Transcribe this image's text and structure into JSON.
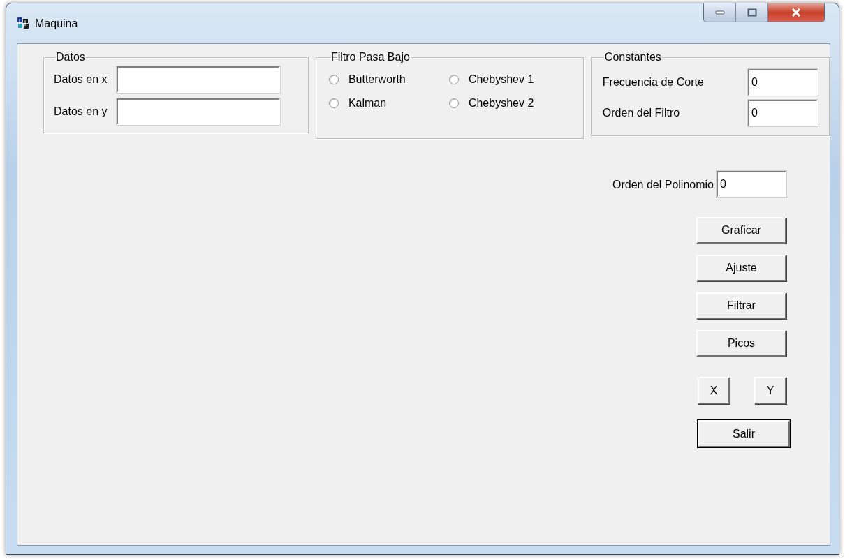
{
  "window": {
    "title": "Maquina"
  },
  "datos": {
    "title": "Datos",
    "fields": [
      {
        "label": "Datos en x"
      },
      {
        "label": "Datos en y"
      }
    ]
  },
  "filtro": {
    "title": "Filtro Pasa Bajo",
    "options": [
      {
        "label": "Butterworth",
        "selected": false
      },
      {
        "label": "Chebyshev 1",
        "selected": false
      },
      {
        "label": "Kalman",
        "selected": false
      },
      {
        "label": "Chebyshev 2",
        "selected": false
      }
    ]
  },
  "constantes": {
    "title": "Constantes",
    "fields": [
      {
        "label": "Frecuencia de Corte",
        "value": "0"
      },
      {
        "label": "Orden del Filtro",
        "value": "0"
      }
    ]
  },
  "polinomio": {
    "label": "Orden del Polinomio",
    "value": "0"
  },
  "actions": [
    {
      "label": "Graficar"
    },
    {
      "label": "Ajuste"
    },
    {
      "label": "Filtrar"
    },
    {
      "label": "Picos"
    }
  ],
  "axis_buttons": [
    {
      "label": "X"
    },
    {
      "label": "Y"
    }
  ],
  "exit_button": {
    "label": "Salir",
    "default": true
  }
}
